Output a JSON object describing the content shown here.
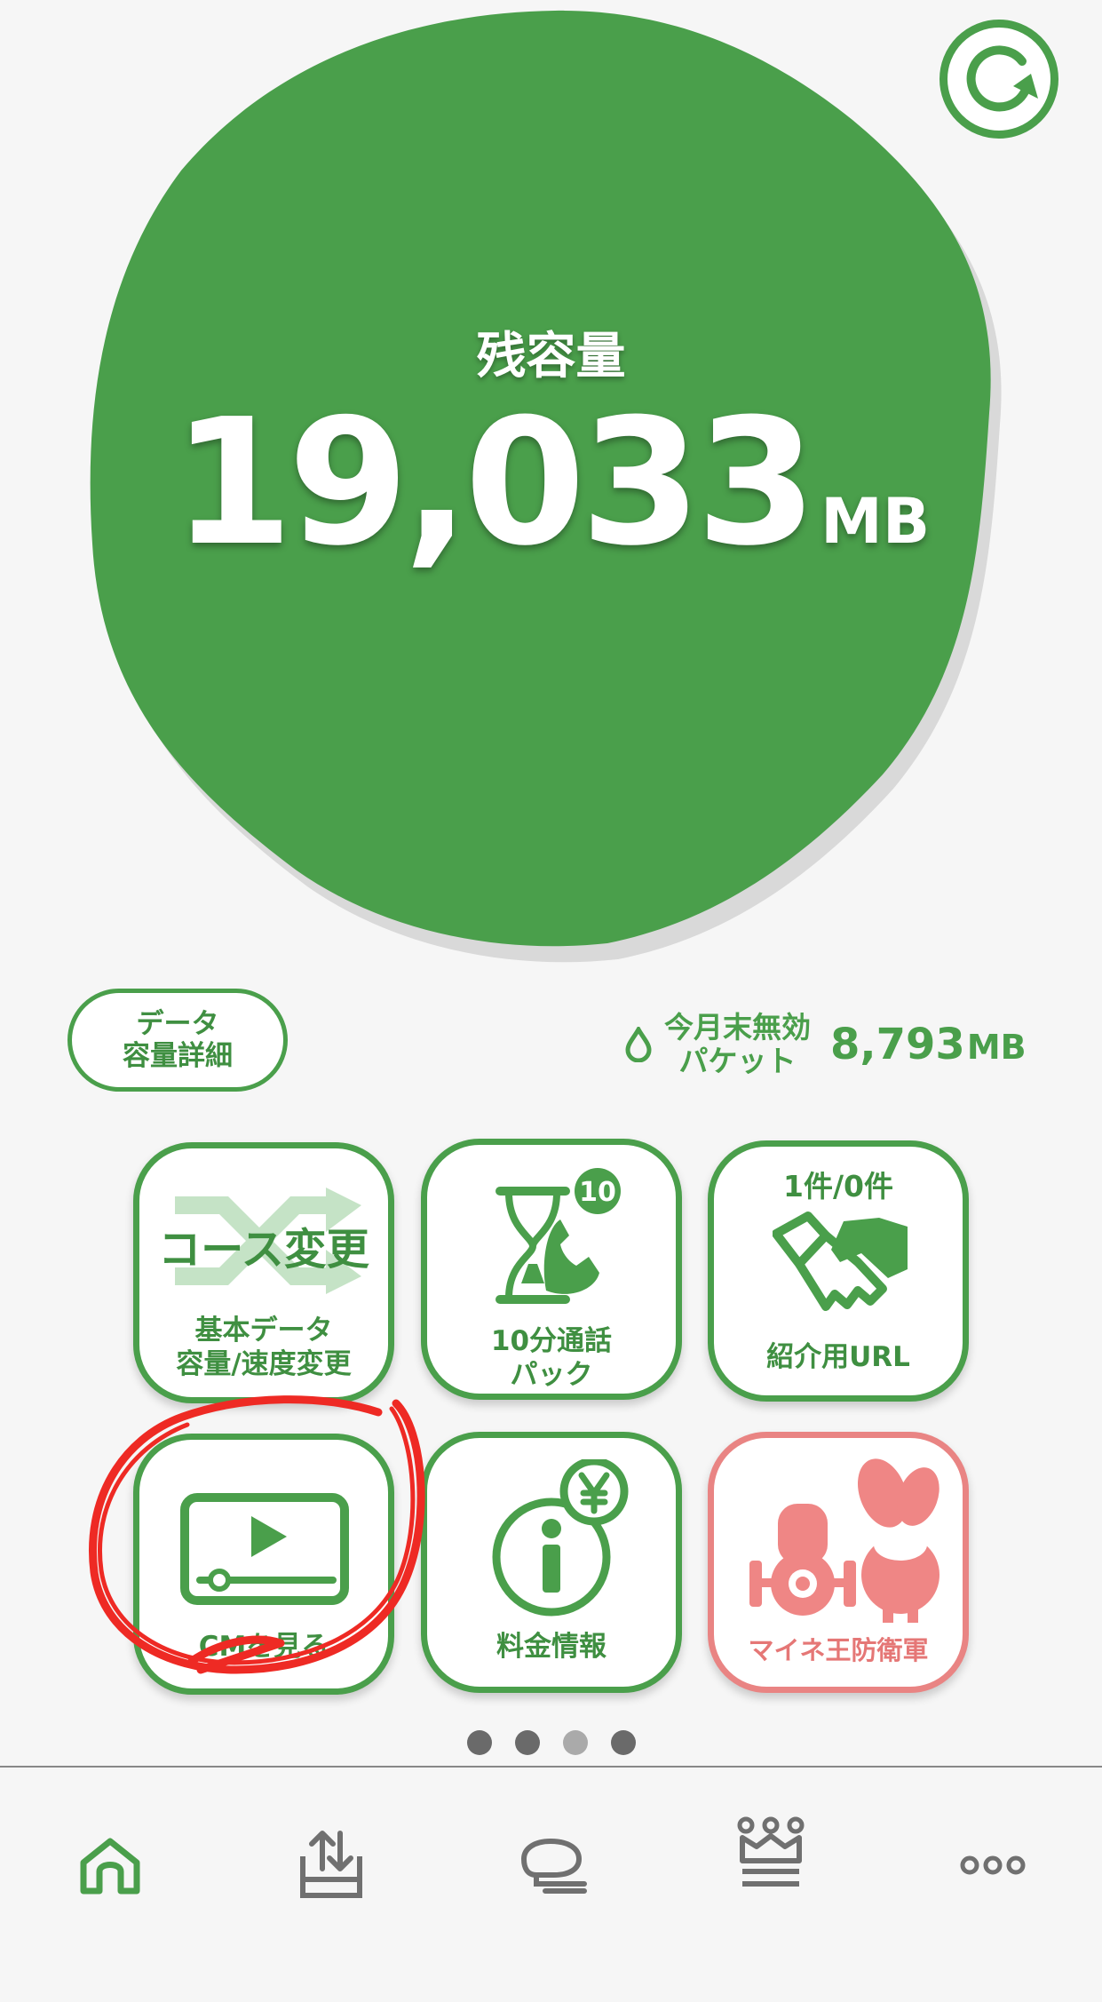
{
  "remaining": {
    "label": "残容量",
    "value": "19,033",
    "unit": "MB"
  },
  "detail_button": {
    "line1": "データ",
    "line2": "容量詳細"
  },
  "expiry": {
    "label_line1": "今月末無効",
    "label_line2": "パケット",
    "value": "8,793",
    "unit": "MB"
  },
  "tiles": [
    {
      "title": "コース変更",
      "cap1": "基本データ",
      "cap2": "容量/速度変更"
    },
    {
      "badge": "10",
      "cap1": "10分通話",
      "cap2": "パック"
    },
    {
      "count": "1件/0件",
      "cap1": "紹介用URL"
    },
    {
      "cap1": "CMを見る"
    },
    {
      "cap1": "料金情報"
    },
    {
      "cap1": "マイネ王防衛軍"
    }
  ],
  "pager": {
    "count": 4,
    "active_index": 2
  },
  "tabs": [
    "home-tab",
    "share-tab",
    "chat-tab",
    "crown-tab",
    "more-tab"
  ],
  "colors": {
    "brand_green": "#4a9f4b",
    "pink": "#e98483",
    "annotation_red": "#ee2a24"
  }
}
